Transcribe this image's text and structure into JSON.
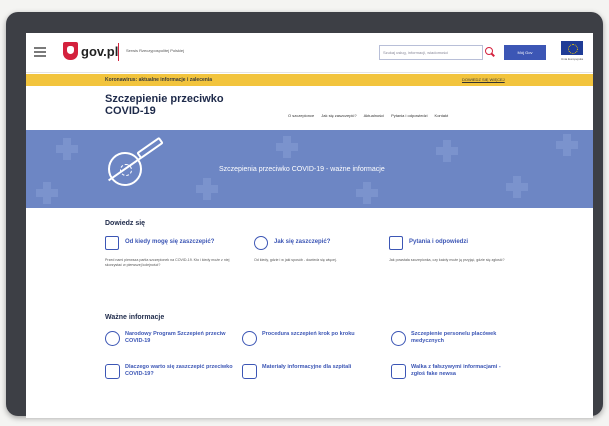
{
  "header": {
    "logo_text": "gov.pl",
    "service_name": "Serwis Rzeczypospolitej Polskiej",
    "search_placeholder": "Szukaj usług, informacji, wiadomości",
    "mojgov_label": "Mój Gov",
    "eu_label": "Unia Europejska"
  },
  "alert": {
    "text": "Koronawirus: aktualne informacje i zalecenia",
    "link": "DOWIEDZ SIĘ WIĘCEJ"
  },
  "page": {
    "title_line1": "Szczepienie przeciwko",
    "title_line2": "COVID-19"
  },
  "nav": {
    "items": [
      "O szczepionce",
      "Jak się zaszczepić?",
      "Aktualności",
      "Pytania i odpowiedzi",
      "Kontakt"
    ]
  },
  "banner": {
    "text": "Szczepienia przeciwko COVID-19 - ważne informacje",
    "bg_color": "#6d86c4"
  },
  "learn": {
    "title": "Dowiedz się",
    "cards": [
      {
        "title": "Od kiedy mogę się zaszczepić?",
        "desc": "Przed nami pierwsza partia szczepionek na COVID-19. Kto i kiedy może z niej skorzystać w pierwszej kolejności?",
        "icon": "calendar-icon"
      },
      {
        "title": "Jak się zaszczepić?",
        "desc": "Od kiedy, gdzie i w jaki sposób - dowiedz się więcej.",
        "icon": "shield-icon"
      },
      {
        "title": "Pytania i odpowiedzi",
        "desc": "Jak powstała szczepionka, czy każdy może ją przyjąć, gdzie się zgłosić?",
        "icon": "chat-icon"
      }
    ]
  },
  "info": {
    "title": "Ważne informacje",
    "items": [
      {
        "title": "Narodowy Program Szczepień przeciw COVID-19",
        "icon": "map-icon"
      },
      {
        "title": "Procedura szczepień krok po kroku",
        "icon": "steps-icon"
      },
      {
        "title": "Szczepienie personelu placówek medycznych",
        "icon": "medical-icon"
      },
      {
        "title": "Dlaczego warto się zaszczepić przeciwko COVID-19?",
        "icon": "document-icon"
      },
      {
        "title": "Materiały informacyjne dla szpitali",
        "icon": "materials-icon"
      },
      {
        "title": "Walka z fałszywymi informacjami - zgłoś fake newsa",
        "icon": "report-icon"
      }
    ]
  },
  "colors": {
    "accent": "#3c56b5",
    "alert": "#f2c43d",
    "brand_red": "#d4213d"
  }
}
